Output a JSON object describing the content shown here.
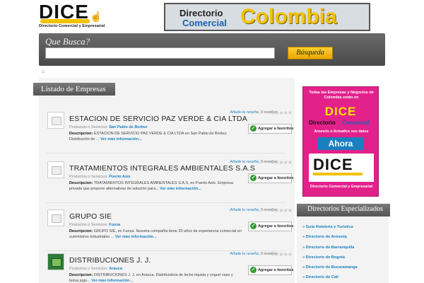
{
  "header": {
    "logo_word": "DICE",
    "logo_sub": "Directorio Comercial y Empresarial",
    "banner_line1": "Directorio",
    "banner_line2": "Comercial",
    "banner_big": "Colombia"
  },
  "search": {
    "label": "Que Busca?",
    "value": "",
    "button": "Búsqueda"
  },
  "list": {
    "header": "Listado de Empresas",
    "items": [
      {
        "title": "ESTACION DE SERVICIO PAZ VERDE & CIA LTDA",
        "prod_label": "Productos o Servicios:",
        "prod_value": "San Pablo de Borbur",
        "desc_label": "Descripcion:",
        "desc": "ESTACION DE SERVICIO PAZ VERDE & CIA LTDA en San Pablo de Borbur, Distribución de ...",
        "more": "Ver más información...",
        "rate_link": "Añade tu reseña",
        "rate_count": "0 reseñas",
        "stars": "★★★★★",
        "fav": "Agregar a favoritos"
      },
      {
        "title": "TRATAMIENTOS INTEGRALES AMBIENTALES S.A.S",
        "prod_label": "Productos o Servicios:",
        "prod_value": "Puerto Asis",
        "desc_label": "Descripcion:",
        "desc": "TRATAMIENTOS INTEGRALES AMBIENTALES S.A.S, en Puerto Asís. Empresa privada que propone alternativas de solución para...",
        "more": "Ver más información...",
        "rate_link": "Añade tu reseña",
        "rate_count": "0 reseñas",
        "stars": "★★★★★",
        "fav": "Agregar a favoritos"
      },
      {
        "title": "GRUPO SIE",
        "prod_label": "Productos o Servicios:",
        "prod_value": "Funza",
        "desc_label": "Descripcion:",
        "desc": "GRUPO SIE, en Funza. Nuestra compañía tiene 20 años de experiencia comercial en suministros industriales ...",
        "more": "Ver más información...",
        "rate_link": "Añade tu reseña",
        "rate_count": "0 reseñas",
        "stars": "★★★★★",
        "fav": "Agregar a favoritos"
      },
      {
        "title": "DISTRIBUCIONES J. J.",
        "prod_label": "Productos o Servicios:",
        "prod_value": "Arauca",
        "desc_label": "Descripcion:",
        "desc": "DISTRIBUCIONES J. J. en Arauca. Distribuidora de leche liquida y yogurt vaso y bolsa jugo...",
        "more": "Ver más información...",
        "rate_link": "Añade tu reseña",
        "rate_count": "0 reseñas",
        "stars": "★★★★★",
        "fav": "Agregar a favoritos"
      }
    ]
  },
  "ad": {
    "top": "Todas las Empresas y Negocios de Colombia están en",
    "dice": "DICE",
    "dir": "Directorio",
    "com": "Comercial",
    "anuncio": "Anuncio o Actualice sus datos",
    "ahora": "Ahora",
    "logo_word": "DICE",
    "bottom": "Directorio Comercial y Empresarial"
  },
  "directories": {
    "header": "Directorios Especializados",
    "items": [
      "Guia Hoteleria y Turistica",
      "Directorio de Armenia",
      "Directorio de Barranquilla",
      "Directorio de Bogotá",
      "Directorio de Bucaramanga",
      "Directorio de Cali"
    ]
  }
}
